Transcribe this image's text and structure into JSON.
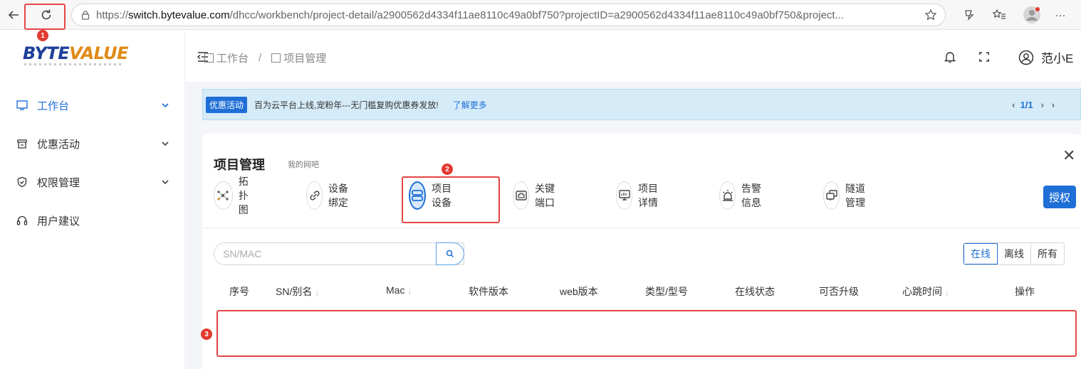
{
  "browser": {
    "url_prefix": "https://",
    "url_host": "switch.bytevalue.com",
    "url_path": "/dhcc/workbench/project-detail/a2900562d4334f11ae8110c49a0bf750?projectID=a2900562d4334f11ae8110c49a0bf750&project...",
    "more_label": "···"
  },
  "logo": {
    "part1": "BYTE",
    "part2": "VALUE"
  },
  "sidebar": {
    "items": [
      {
        "label": "工作台",
        "icon": "monitor-icon"
      },
      {
        "label": "优惠活动",
        "icon": "store-icon"
      },
      {
        "label": "权限管理",
        "icon": "shield-check-icon"
      },
      {
        "label": "用户建议",
        "icon": "headset-icon"
      }
    ]
  },
  "header": {
    "breadcrumb": [
      "工作台",
      "项目管理"
    ],
    "breadcrumb_sep": "/",
    "user_name": "范小E"
  },
  "notice": {
    "tag": "优惠活动",
    "text": "百为云平台上线,宠粉年---无门槛复购优惠券发放!",
    "more": "了解更多",
    "pager_current": "1/1"
  },
  "card": {
    "title": "项目管理",
    "subtitle": "我的网吧",
    "close": "✕",
    "tabs": [
      {
        "label": "拓扑图",
        "icon": "topology-icon"
      },
      {
        "label": "设备绑定",
        "icon": "link-icon"
      },
      {
        "label": "项目设备",
        "icon": "device-icon"
      },
      {
        "label": "关键端口",
        "icon": "port-icon"
      },
      {
        "label": "项目详情",
        "icon": "detail-icon"
      },
      {
        "label": "告警信息",
        "icon": "alarm-icon"
      },
      {
        "label": "隧道管理",
        "icon": "tunnel-icon"
      }
    ],
    "active_tab": "项目设备",
    "auth_button": "授权",
    "search_placeholder": "SN/MAC",
    "filters": [
      "在线",
      "离线",
      "所有"
    ],
    "active_filter": "在线",
    "columns": [
      "序号",
      "SN/别名",
      "Mac",
      "软件版本",
      "web版本",
      "类型/型号",
      "在线状态",
      "可否升级",
      "心跳时间",
      "操作"
    ]
  },
  "annotations": [
    "1",
    "2",
    "3"
  ],
  "colors": {
    "accent": "#1f6fd6",
    "annotation": "#e54545",
    "notice_bg": "#d5ebf8"
  }
}
